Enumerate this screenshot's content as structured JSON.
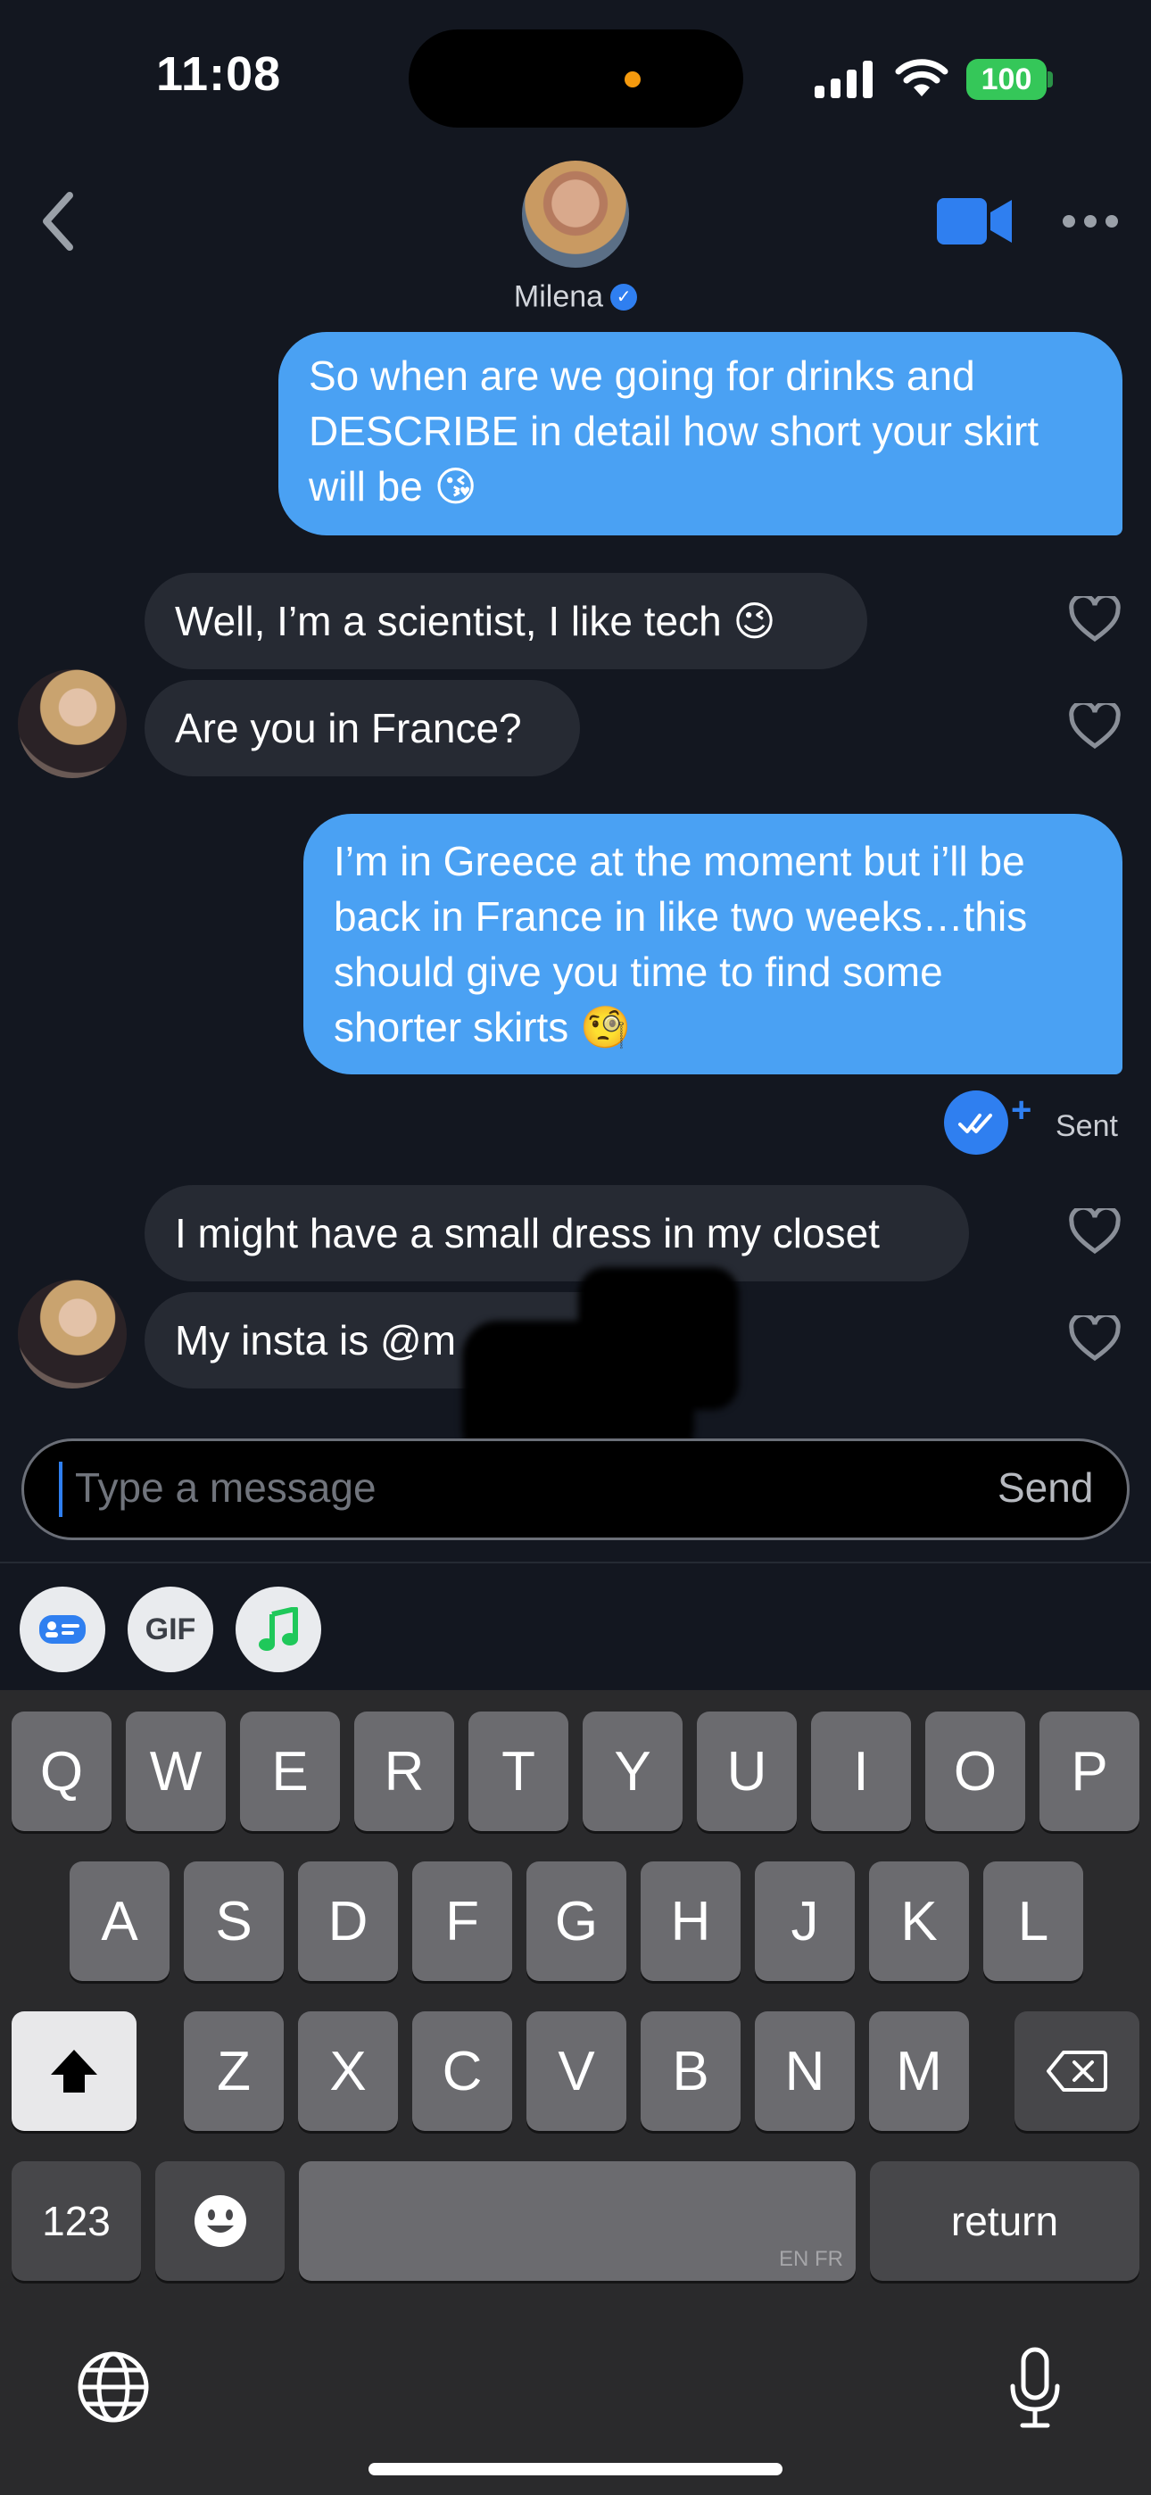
{
  "status": {
    "time": "11:08",
    "battery": "100"
  },
  "header": {
    "name": "Milena"
  },
  "messages": [
    {
      "dir": "out",
      "lines": [
        "So when are we going for drinks and",
        "DESCRIBE in detail how short your skirt",
        "will be 😘"
      ]
    },
    {
      "dir": "in",
      "lines": [
        "Well, I’m a scientist, I like tech 😉"
      ]
    },
    {
      "dir": "in",
      "lines": [
        "Are you in France?"
      ]
    },
    {
      "dir": "out",
      "lines": [
        "I’m in Greece at the moment but i’ll be",
        "back in France in like two weeks…this",
        "should give you time to find some",
        "shorter skirts 🧐"
      ]
    },
    {
      "dir": "in",
      "lines": [
        "I might have a small dress in my closet"
      ]
    },
    {
      "dir": "in",
      "lines": [
        "My insta is @m"
      ]
    }
  ],
  "sent_status": {
    "plus": "+",
    "label": "Sent"
  },
  "composer": {
    "placeholder": "Type a message",
    "send_label": "Send"
  },
  "tools": {
    "gif_label": "GIF"
  },
  "keyboard": {
    "row1": [
      "Q",
      "W",
      "E",
      "R",
      "T",
      "Y",
      "U",
      "I",
      "O",
      "P"
    ],
    "row2": [
      "A",
      "S",
      "D",
      "F",
      "G",
      "H",
      "J",
      "K",
      "L"
    ],
    "row3": [
      "Z",
      "X",
      "C",
      "V",
      "B",
      "N",
      "M"
    ],
    "numbers_label": "123",
    "space_lang": "EN FR",
    "return_label": "return"
  },
  "colors": {
    "outgoing": "#4aa1f3",
    "incoming": "#262a33",
    "accent": "#2f7ff0",
    "background": "#131720"
  }
}
